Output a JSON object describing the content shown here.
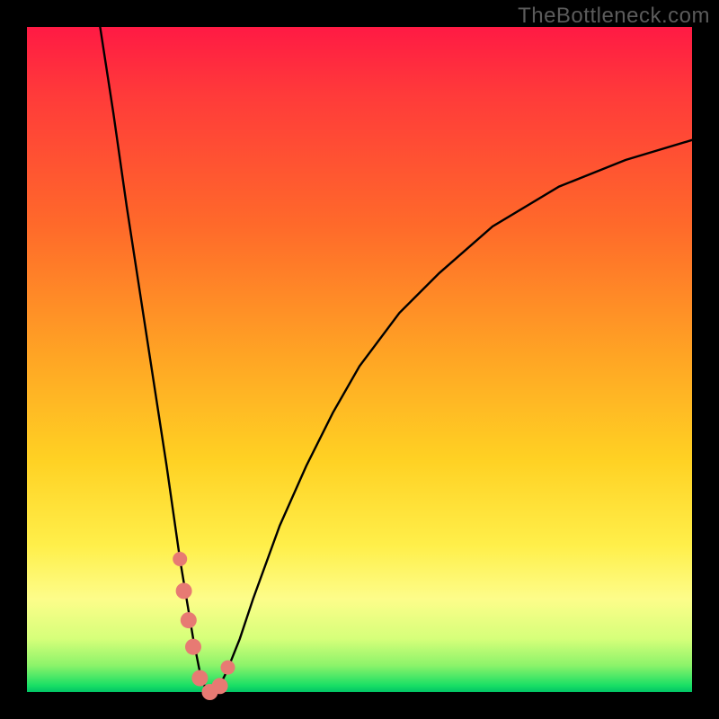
{
  "watermark": "TheBottleneck.com",
  "colors": {
    "frame": "#000000",
    "curve": "#000000",
    "marker": "#e77a73"
  },
  "chart_data": {
    "type": "line",
    "title": "",
    "xlabel": "",
    "ylabel": "",
    "xlim": [
      0,
      100
    ],
    "ylim": [
      0,
      100
    ],
    "grid": false,
    "note": "V-shaped bottleneck curve; y≈100 indicates severe bottleneck (red), y≈0 indicates balanced (green). Values are estimated from pixel positions.",
    "series": [
      {
        "name": "bottleneck-curve",
        "x": [
          11,
          13,
          15,
          17,
          19,
          21,
          22,
          23,
          24,
          25,
          26,
          27,
          28,
          29,
          30,
          32,
          34,
          38,
          42,
          46,
          50,
          56,
          62,
          70,
          80,
          90,
          100
        ],
        "y": [
          100,
          87,
          73,
          60,
          47,
          34,
          27,
          20,
          14,
          8,
          3,
          0,
          0,
          1,
          3,
          8,
          14,
          25,
          34,
          42,
          49,
          57,
          63,
          70,
          76,
          80,
          83
        ]
      }
    ],
    "markers": {
      "name": "highlighted-points",
      "x": [
        23.0,
        23.6,
        24.3,
        25.0,
        26.0,
        27.5,
        29.0,
        30.2
      ],
      "y": [
        20.0,
        15.2,
        10.8,
        6.8,
        2.1,
        0.0,
        0.9,
        3.7
      ]
    }
  }
}
